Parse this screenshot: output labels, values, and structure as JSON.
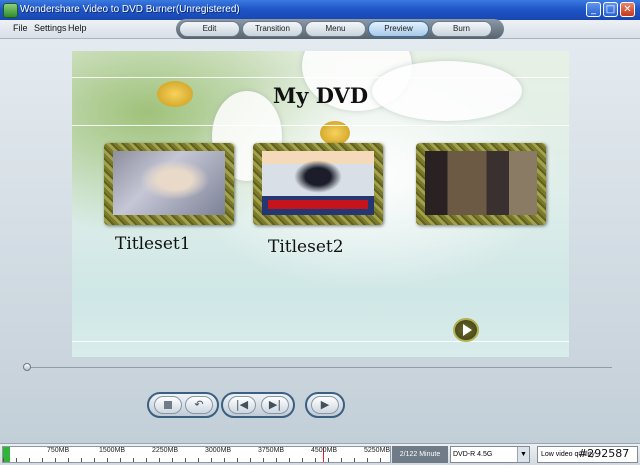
{
  "window": {
    "title": "Wondershare Video to DVD Burner(Unregistered)",
    "min_glyph": "_",
    "max_glyph": "□",
    "close_glyph": "✕"
  },
  "menu": {
    "file": "File",
    "settings": "Settings",
    "help": "Help"
  },
  "tabs": [
    {
      "label": "Edit"
    },
    {
      "label": "Transition"
    },
    {
      "label": "Menu"
    },
    {
      "label": "Preview",
      "active": true
    },
    {
      "label": "Burn"
    }
  ],
  "preview": {
    "title": "My DVD",
    "titlesets": [
      {
        "label": "Titleset1"
      },
      {
        "label": "Titleset2"
      },
      {
        "label": ""
      }
    ]
  },
  "controls": {
    "stop_glyph": "",
    "back_glyph": "↶",
    "prev_glyph": "|◀",
    "next_glyph": "▶|",
    "play_glyph": "▶"
  },
  "status": {
    "capacity_ticks": [
      "750MB",
      "1500MB",
      "2250MB",
      "3000MB",
      "3750MB",
      "4500MB",
      "5250MB"
    ],
    "used_fraction": 0.018,
    "minutes": "2/122 Minute",
    "disc_type": "DVD-R 4.5G",
    "quality": "Low video quality",
    "watermark": "#292587"
  }
}
